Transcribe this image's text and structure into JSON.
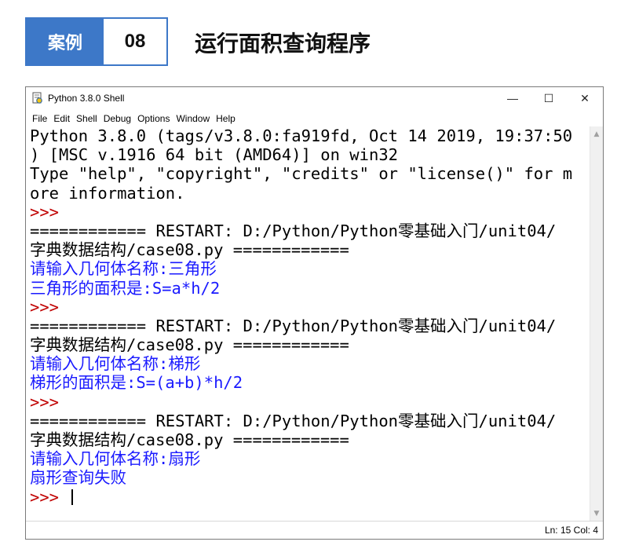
{
  "banner": {
    "tag": "案例",
    "number": "08",
    "title": "运行面积查询程序"
  },
  "window": {
    "title": "Python 3.8.0 Shell",
    "controls": {
      "minimize": "—",
      "maximize": "☐",
      "close": "✕"
    },
    "menu": [
      "File",
      "Edit",
      "Shell",
      "Debug",
      "Options",
      "Window",
      "Help"
    ]
  },
  "shell": {
    "lines": [
      {
        "text": "Python 3.8.0 (tags/v3.8.0:fa919fd, Oct 14 2019, 19:37:50",
        "kind": "normal"
      },
      {
        "text": ") [MSC v.1916 64 bit (AMD64)] on win32",
        "kind": "normal"
      },
      {
        "text": "Type \"help\", \"copyright\", \"credits\" or \"license()\" for m",
        "kind": "normal"
      },
      {
        "text": "ore information.",
        "kind": "normal"
      },
      {
        "text": ">>>",
        "kind": "prompt"
      },
      {
        "text": "============ RESTART: D:/Python/Python零基础入门/unit04/",
        "kind": "normal"
      },
      {
        "text": "字典数据结构/case08.py ============",
        "kind": "normal"
      },
      {
        "text": "请输入几何体名称:三角形",
        "kind": "stdout"
      },
      {
        "text": "三角形的面积是:S=a*h/2",
        "kind": "stdout"
      },
      {
        "text": ">>>",
        "kind": "prompt"
      },
      {
        "text": "============ RESTART: D:/Python/Python零基础入门/unit04/",
        "kind": "normal"
      },
      {
        "text": "字典数据结构/case08.py ============",
        "kind": "normal"
      },
      {
        "text": "请输入几何体名称:梯形",
        "kind": "stdout"
      },
      {
        "text": "梯形的面积是:S=(a+b)*h/2",
        "kind": "stdout"
      },
      {
        "text": ">>>",
        "kind": "prompt"
      },
      {
        "text": "============ RESTART: D:/Python/Python零基础入门/unit04/",
        "kind": "normal"
      },
      {
        "text": "字典数据结构/case08.py ============",
        "kind": "normal"
      },
      {
        "text": "请输入几何体名称:扇形",
        "kind": "stdout"
      },
      {
        "text": "扇形查询失败",
        "kind": "stdout"
      },
      {
        "text": ">>> ",
        "kind": "prompt",
        "cursor": true
      }
    ]
  },
  "status": "Ln: 15  Col: 4",
  "colors": {
    "accent": "#3d78c8",
    "prompt": "#c00000",
    "stdout": "#1a1aff"
  }
}
